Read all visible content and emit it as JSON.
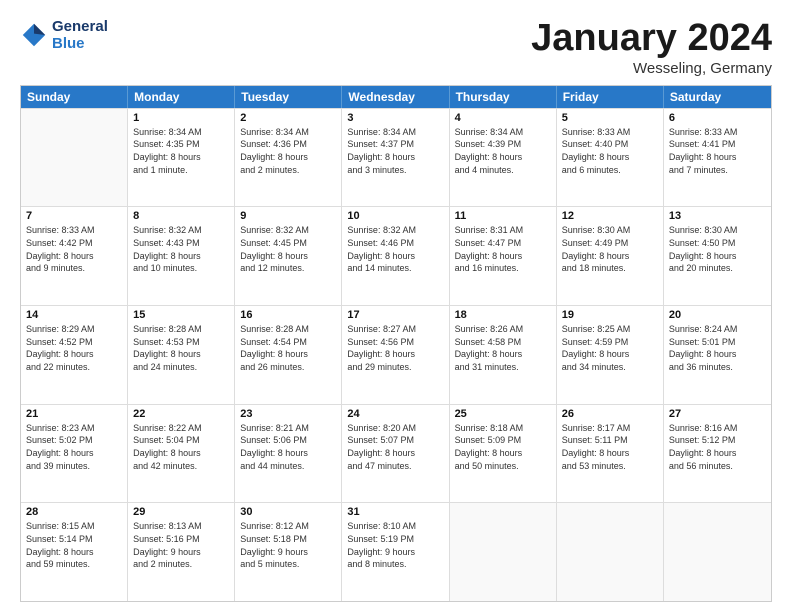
{
  "header": {
    "logo_line1": "General",
    "logo_line2": "Blue",
    "month_title": "January 2024",
    "location": "Wesseling, Germany"
  },
  "weekdays": [
    "Sunday",
    "Monday",
    "Tuesday",
    "Wednesday",
    "Thursday",
    "Friday",
    "Saturday"
  ],
  "weeks": [
    [
      {
        "day": "",
        "lines": []
      },
      {
        "day": "1",
        "lines": [
          "Sunrise: 8:34 AM",
          "Sunset: 4:35 PM",
          "Daylight: 8 hours",
          "and 1 minute."
        ]
      },
      {
        "day": "2",
        "lines": [
          "Sunrise: 8:34 AM",
          "Sunset: 4:36 PM",
          "Daylight: 8 hours",
          "and 2 minutes."
        ]
      },
      {
        "day": "3",
        "lines": [
          "Sunrise: 8:34 AM",
          "Sunset: 4:37 PM",
          "Daylight: 8 hours",
          "and 3 minutes."
        ]
      },
      {
        "day": "4",
        "lines": [
          "Sunrise: 8:34 AM",
          "Sunset: 4:39 PM",
          "Daylight: 8 hours",
          "and 4 minutes."
        ]
      },
      {
        "day": "5",
        "lines": [
          "Sunrise: 8:33 AM",
          "Sunset: 4:40 PM",
          "Daylight: 8 hours",
          "and 6 minutes."
        ]
      },
      {
        "day": "6",
        "lines": [
          "Sunrise: 8:33 AM",
          "Sunset: 4:41 PM",
          "Daylight: 8 hours",
          "and 7 minutes."
        ]
      }
    ],
    [
      {
        "day": "7",
        "lines": [
          "Sunrise: 8:33 AM",
          "Sunset: 4:42 PM",
          "Daylight: 8 hours",
          "and 9 minutes."
        ]
      },
      {
        "day": "8",
        "lines": [
          "Sunrise: 8:32 AM",
          "Sunset: 4:43 PM",
          "Daylight: 8 hours",
          "and 10 minutes."
        ]
      },
      {
        "day": "9",
        "lines": [
          "Sunrise: 8:32 AM",
          "Sunset: 4:45 PM",
          "Daylight: 8 hours",
          "and 12 minutes."
        ]
      },
      {
        "day": "10",
        "lines": [
          "Sunrise: 8:32 AM",
          "Sunset: 4:46 PM",
          "Daylight: 8 hours",
          "and 14 minutes."
        ]
      },
      {
        "day": "11",
        "lines": [
          "Sunrise: 8:31 AM",
          "Sunset: 4:47 PM",
          "Daylight: 8 hours",
          "and 16 minutes."
        ]
      },
      {
        "day": "12",
        "lines": [
          "Sunrise: 8:30 AM",
          "Sunset: 4:49 PM",
          "Daylight: 8 hours",
          "and 18 minutes."
        ]
      },
      {
        "day": "13",
        "lines": [
          "Sunrise: 8:30 AM",
          "Sunset: 4:50 PM",
          "Daylight: 8 hours",
          "and 20 minutes."
        ]
      }
    ],
    [
      {
        "day": "14",
        "lines": [
          "Sunrise: 8:29 AM",
          "Sunset: 4:52 PM",
          "Daylight: 8 hours",
          "and 22 minutes."
        ]
      },
      {
        "day": "15",
        "lines": [
          "Sunrise: 8:28 AM",
          "Sunset: 4:53 PM",
          "Daylight: 8 hours",
          "and 24 minutes."
        ]
      },
      {
        "day": "16",
        "lines": [
          "Sunrise: 8:28 AM",
          "Sunset: 4:54 PM",
          "Daylight: 8 hours",
          "and 26 minutes."
        ]
      },
      {
        "day": "17",
        "lines": [
          "Sunrise: 8:27 AM",
          "Sunset: 4:56 PM",
          "Daylight: 8 hours",
          "and 29 minutes."
        ]
      },
      {
        "day": "18",
        "lines": [
          "Sunrise: 8:26 AM",
          "Sunset: 4:58 PM",
          "Daylight: 8 hours",
          "and 31 minutes."
        ]
      },
      {
        "day": "19",
        "lines": [
          "Sunrise: 8:25 AM",
          "Sunset: 4:59 PM",
          "Daylight: 8 hours",
          "and 34 minutes."
        ]
      },
      {
        "day": "20",
        "lines": [
          "Sunrise: 8:24 AM",
          "Sunset: 5:01 PM",
          "Daylight: 8 hours",
          "and 36 minutes."
        ]
      }
    ],
    [
      {
        "day": "21",
        "lines": [
          "Sunrise: 8:23 AM",
          "Sunset: 5:02 PM",
          "Daylight: 8 hours",
          "and 39 minutes."
        ]
      },
      {
        "day": "22",
        "lines": [
          "Sunrise: 8:22 AM",
          "Sunset: 5:04 PM",
          "Daylight: 8 hours",
          "and 42 minutes."
        ]
      },
      {
        "day": "23",
        "lines": [
          "Sunrise: 8:21 AM",
          "Sunset: 5:06 PM",
          "Daylight: 8 hours",
          "and 44 minutes."
        ]
      },
      {
        "day": "24",
        "lines": [
          "Sunrise: 8:20 AM",
          "Sunset: 5:07 PM",
          "Daylight: 8 hours",
          "and 47 minutes."
        ]
      },
      {
        "day": "25",
        "lines": [
          "Sunrise: 8:18 AM",
          "Sunset: 5:09 PM",
          "Daylight: 8 hours",
          "and 50 minutes."
        ]
      },
      {
        "day": "26",
        "lines": [
          "Sunrise: 8:17 AM",
          "Sunset: 5:11 PM",
          "Daylight: 8 hours",
          "and 53 minutes."
        ]
      },
      {
        "day": "27",
        "lines": [
          "Sunrise: 8:16 AM",
          "Sunset: 5:12 PM",
          "Daylight: 8 hours",
          "and 56 minutes."
        ]
      }
    ],
    [
      {
        "day": "28",
        "lines": [
          "Sunrise: 8:15 AM",
          "Sunset: 5:14 PM",
          "Daylight: 8 hours",
          "and 59 minutes."
        ]
      },
      {
        "day": "29",
        "lines": [
          "Sunrise: 8:13 AM",
          "Sunset: 5:16 PM",
          "Daylight: 9 hours",
          "and 2 minutes."
        ]
      },
      {
        "day": "30",
        "lines": [
          "Sunrise: 8:12 AM",
          "Sunset: 5:18 PM",
          "Daylight: 9 hours",
          "and 5 minutes."
        ]
      },
      {
        "day": "31",
        "lines": [
          "Sunrise: 8:10 AM",
          "Sunset: 5:19 PM",
          "Daylight: 9 hours",
          "and 8 minutes."
        ]
      },
      {
        "day": "",
        "lines": []
      },
      {
        "day": "",
        "lines": []
      },
      {
        "day": "",
        "lines": []
      }
    ]
  ]
}
